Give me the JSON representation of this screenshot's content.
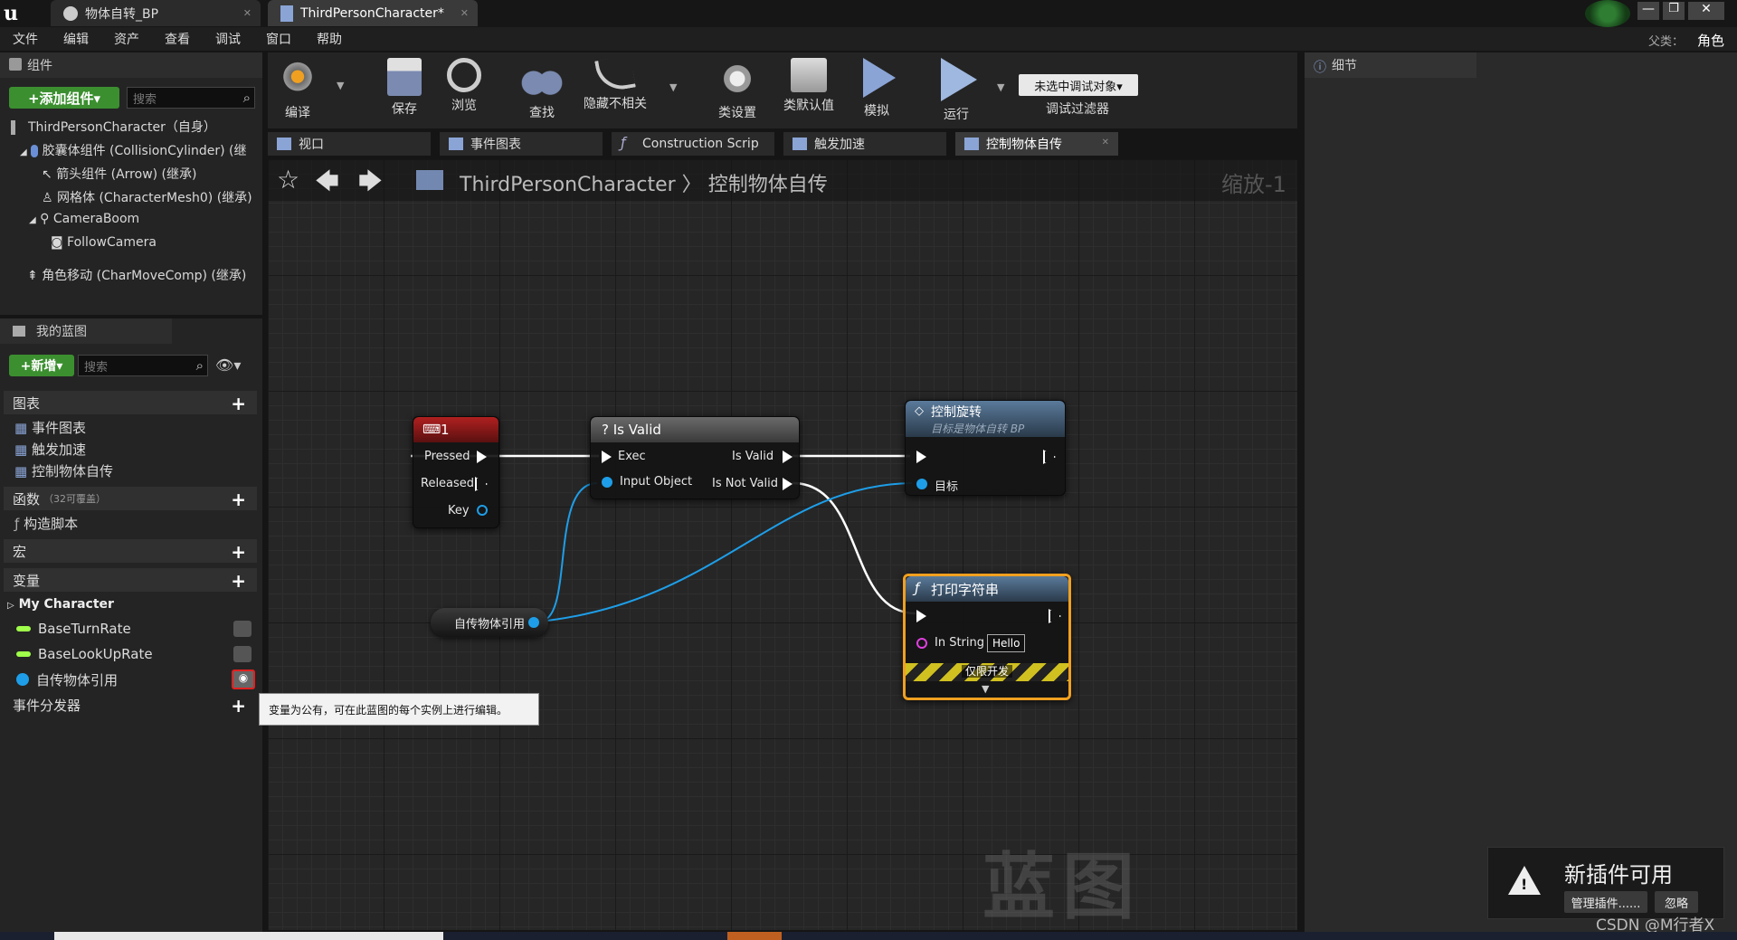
{
  "doc_tabs": [
    "物体自转_BP",
    "ThirdPersonCharacter*"
  ],
  "menu": [
    "文件",
    "编辑",
    "资产",
    "查看",
    "调试",
    "窗口",
    "帮助"
  ],
  "parent_class": {
    "label": "父类：",
    "value": "角色"
  },
  "components": {
    "title": "组件",
    "add_button": "+添加组件▾",
    "search_placeholder": "搜索",
    "root": "ThirdPersonCharacter（自身）",
    "tree": [
      "胶囊体组件 (CollisionCylinder) (继",
      "箭头组件 (Arrow) (继承)",
      "网格体 (CharacterMesh0) (继承)",
      "CameraBoom",
      "FollowCamera",
      "角色移动 (CharMoveComp) (继承)"
    ]
  },
  "my_blueprint": {
    "title": "我的蓝图",
    "new_button": "+新增▾",
    "search_placeholder": "搜索",
    "graphs_label": "图表",
    "graphs": [
      "事件图表",
      "触发加速",
      "控制物体自传"
    ],
    "functions_label": "函数",
    "functions_note": "（32可覆盖）",
    "functions": [
      "构造脚本"
    ],
    "macros_label": "宏",
    "variables_label": "变量",
    "var_category": "My Character",
    "variables": [
      "BaseTurnRate",
      "BaseLookUpRate",
      "自传物体引用"
    ],
    "dispatchers_label": "事件分发器"
  },
  "tooltip": "变量为公有，可在此蓝图的每个实例上进行编辑。",
  "toolbar": {
    "buttons": [
      "编译",
      "保存",
      "浏览",
      "查找",
      "隐藏不相关",
      "类设置",
      "类默认值",
      "模拟",
      "运行"
    ],
    "debug_select": "未选中调试对象▾",
    "debug_filter": "调试过滤器"
  },
  "graph_tabs": [
    "视口",
    "事件图表",
    "Construction Scrip",
    "触发加速",
    "控制物体自传"
  ],
  "breadcrumb": {
    "root": "ThirdPersonCharacter",
    "sep": "〉",
    "current": "控制物体自传",
    "zoom": "缩放-1"
  },
  "details": {
    "title": "细节"
  },
  "watermark": "蓝图",
  "nodes": {
    "key": {
      "title": "1",
      "pressed": "Pressed",
      "released": "Released",
      "key": "Key"
    },
    "isvalid": {
      "title": "? Is Valid",
      "exec": "Exec",
      "input": "Input Object",
      "valid": "Is Valid",
      "notvalid": "Is Not Valid"
    },
    "rotate": {
      "title": "控制旋转",
      "subtitle": "目标是物体自转 BP",
      "target": "目标"
    },
    "print": {
      "title": "打印字符串",
      "instring": "In String",
      "value": "Hello",
      "devonly": "仅限开发"
    },
    "varget": {
      "label": "自传物体引用"
    }
  },
  "plugin": {
    "title": "新插件可用",
    "manage": "管理插件......",
    "ignore": "忽略"
  },
  "credit": "CSDN @M行者X",
  "colors": {
    "accent_green": "#3b8f2f",
    "pin_blue": "#1e9ee8",
    "key_node": "#8c1a1a",
    "print_border": "#f0a020"
  }
}
